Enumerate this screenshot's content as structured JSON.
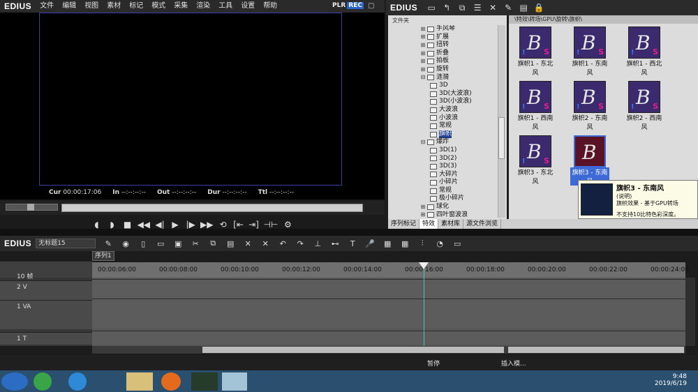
{
  "app": {
    "logo": "EDIUS"
  },
  "menubar": {
    "items": [
      "文件",
      "编辑",
      "视图",
      "素材",
      "标记",
      "模式",
      "采集",
      "渲染",
      "工具",
      "设置",
      "帮助"
    ],
    "plr": "PLR",
    "rec": "REC"
  },
  "timecode": {
    "cur_label": "Cur",
    "cur": "00:00:17:06",
    "in_label": "In",
    "in": "--:--:--:--",
    "out_label": "Out",
    "out": "--:--:--:--",
    "dur_label": "Dur",
    "dur": "--:--:--:--",
    "ttl_label": "Ttl",
    "ttl": "--:--:--:--"
  },
  "bin": {
    "logo": "EDIUS",
    "folder_header": "文件夹",
    "path": "\\特效\\转场\\GPU\\旋转\\旗帜\\"
  },
  "tree": [
    {
      "label": "手风琴",
      "pm": "+"
    },
    {
      "label": "扩展",
      "pm": "+"
    },
    {
      "label": "扭转",
      "pm": "+"
    },
    {
      "label": "折叠",
      "pm": "+"
    },
    {
      "label": "拍板",
      "pm": "+"
    },
    {
      "label": "旋转",
      "pm": "+"
    },
    {
      "label": "涟漪",
      "pm": "-"
    },
    {
      "label": "3D",
      "pm": ""
    },
    {
      "label": "3D(大波浪)",
      "pm": ""
    },
    {
      "label": "3D(小波浪)",
      "pm": ""
    },
    {
      "label": "大波浪",
      "pm": ""
    },
    {
      "label": "小波浪",
      "pm": ""
    },
    {
      "label": "常规",
      "pm": ""
    },
    {
      "label": "旗帜",
      "pm": "",
      "sel": true
    },
    {
      "label": "爆炸",
      "pm": "-"
    },
    {
      "label": "3D(1)",
      "pm": ""
    },
    {
      "label": "3D(2)",
      "pm": ""
    },
    {
      "label": "3D(3)",
      "pm": ""
    },
    {
      "label": "大碎片",
      "pm": ""
    },
    {
      "label": "小碎片",
      "pm": ""
    },
    {
      "label": "常规",
      "pm": ""
    },
    {
      "label": "极小碎片",
      "pm": ""
    },
    {
      "label": "球化",
      "pm": "+"
    },
    {
      "label": "四叶窗波浪",
      "pm": "+"
    }
  ],
  "effects": [
    {
      "caption": "旗帜1 - 东北风"
    },
    {
      "caption": "旗帜1 - 东南风"
    },
    {
      "caption": "旗帜1 - 西北风"
    },
    {
      "caption": "旗帜1 - 西南风"
    },
    {
      "caption": "旗帜2 - 东南风"
    },
    {
      "caption": "旗帜2 - 西南风"
    },
    {
      "caption": "旗帜3 - 东北风"
    },
    {
      "caption": "旗帜3 - 东南风",
      "sel": true
    }
  ],
  "tooltip": {
    "title": "旗帜3 - 东南风",
    "line1": "(说明)",
    "line2": "旗帜效果 - 基于GPU转场",
    "line3": "不支持10比特色彩深度。"
  },
  "tabs": [
    {
      "label": "序列标记"
    },
    {
      "label": "特效",
      "active": true
    },
    {
      "label": "素材库"
    },
    {
      "label": "源文件浏览"
    }
  ],
  "timeline": {
    "logo": "EDIUS",
    "project": "无标题15",
    "sequence": "序列1",
    "scale": "10 帧",
    "ticks": [
      "00:00:06:00",
      "00:00:08:00",
      "00:00:10:00",
      "00:00:12:00",
      "00:00:14:00",
      "00:00:16:00",
      "00:00:18:00",
      "00:00:20:00",
      "00:00:22:00",
      "00:00:24:00"
    ],
    "tracks": [
      {
        "name": "2 V"
      },
      {
        "name": "1 VA"
      },
      {
        "name": "1 T"
      }
    ]
  },
  "status": {
    "state": "暂停",
    "mode": "插入模..."
  },
  "taskbar": {
    "time": "9:48",
    "date": "2019/6/19"
  }
}
